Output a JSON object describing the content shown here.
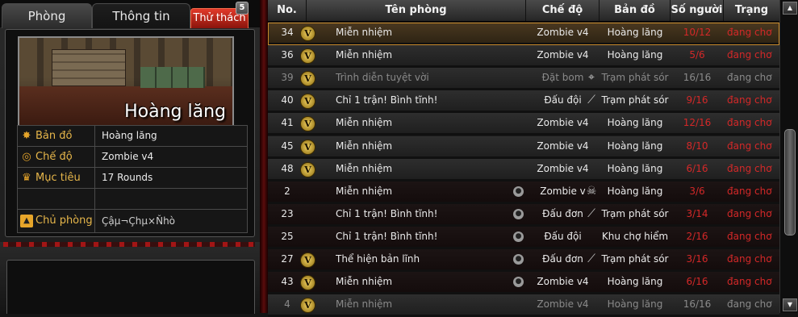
{
  "tabs": {
    "phong": "Phòng",
    "thong_tin": "Thông tin",
    "thu_thach": "Thử thách",
    "thu_thach_badge": "5"
  },
  "map_preview": {
    "name": "Hoàng lăng"
  },
  "info": {
    "ban_do_label": "Bản đồ",
    "ban_do_value": "Hoàng lăng",
    "che_do_label": "Chế độ",
    "che_do_value": "Zombie v4",
    "muc_tieu_label": "Mục tiêu",
    "muc_tieu_value": "17 Rounds",
    "chu_phong_label": "Chủ phòng",
    "chu_phong_value": "Çậµ¬Çhµ×Ňhò"
  },
  "table": {
    "headers": {
      "no": "No.",
      "name": "Tên phòng",
      "mode": "Chế độ",
      "map": "Bản đồ",
      "players": "Số người",
      "status": "Trạng thái"
    },
    "rows": [
      {
        "no": "34",
        "name": "Miễn nhiệm",
        "mode": "Zombie v4",
        "map": "Hoàng lăng",
        "players": "10/12",
        "status": "đang chơ"
      },
      {
        "no": "36",
        "name": "Miễn nhiệm",
        "mode": "Zombie v4",
        "map": "Hoàng lăng",
        "players": "5/6",
        "status": "đang chơ"
      },
      {
        "no": "39",
        "name": "Trình diễn tuyệt vời",
        "mode": "Đặt bom",
        "map": "Trạm phát sór",
        "players": "16/16",
        "status": "đang chơ"
      },
      {
        "no": "40",
        "name": "Chỉ 1 trận! Bình tĩnh!",
        "mode": "Đấu đội",
        "map": "Trạm phát sór",
        "players": "9/16",
        "status": "đang chơ"
      },
      {
        "no": "41",
        "name": "Miễn nhiệm",
        "mode": "Zombie v4",
        "map": "Hoàng lăng",
        "players": "12/16",
        "status": "đang chơ"
      },
      {
        "no": "45",
        "name": "Miễn nhiệm",
        "mode": "Zombie v4",
        "map": "Hoàng lăng",
        "players": "8/10",
        "status": "đang chơ"
      },
      {
        "no": "48",
        "name": "Miễn nhiệm",
        "mode": "Zombie v4",
        "map": "Hoàng lăng",
        "players": "6/16",
        "status": "đang chơ"
      },
      {
        "no": "2",
        "name": "Miễn nhiệm",
        "mode": "Zombie v",
        "map": "Hoàng lăng",
        "players": "3/6",
        "status": "đang chơ"
      },
      {
        "no": "23",
        "name": "Chỉ 1 trận! Bình tĩnh!",
        "mode": "Đấu đơn",
        "map": "Trạm phát sór",
        "players": "3/14",
        "status": "đang chơ"
      },
      {
        "no": "25",
        "name": "Chỉ 1 trận! Bình tĩnh!",
        "mode": "Đấu đội",
        "map": "Khu chợ hiểm",
        "players": "2/16",
        "status": "đang chơ"
      },
      {
        "no": "27",
        "name": "Thể hiện bản lĩnh",
        "mode": "Đấu đơn",
        "map": "Trạm phát sór",
        "players": "3/16",
        "status": "đang chơ"
      },
      {
        "no": "43",
        "name": "Miễn nhiệm",
        "mode": "Zombie v4",
        "map": "Hoàng lăng",
        "players": "6/16",
        "status": "đang chơ"
      },
      {
        "no": "4",
        "name": "Miễn nhiệm",
        "mode": "Zombie v4",
        "map": "Hoàng lăng",
        "players": "16/16",
        "status": "đang chơ"
      }
    ]
  },
  "row_flags": {
    "selected_index": 0,
    "dim_rows": [
      2,
      12
    ],
    "locked_rows": [
      7,
      8,
      9,
      10,
      11
    ],
    "v_icon_rows": [
      0,
      1,
      2,
      3,
      4,
      5,
      6,
      10,
      11,
      12
    ],
    "lock_icon_rows": [
      7,
      8,
      9,
      10,
      11
    ],
    "mode_icon_rows": {
      "2": "crosshair-icon",
      "3": "knife-icon",
      "7": "zombie-icon",
      "8": "knife-icon",
      "10": "knife-icon"
    }
  },
  "colors": {
    "accent_red": "#d42828",
    "label_gold": "#e6b64a",
    "selected_outline": "#c88a2a"
  }
}
